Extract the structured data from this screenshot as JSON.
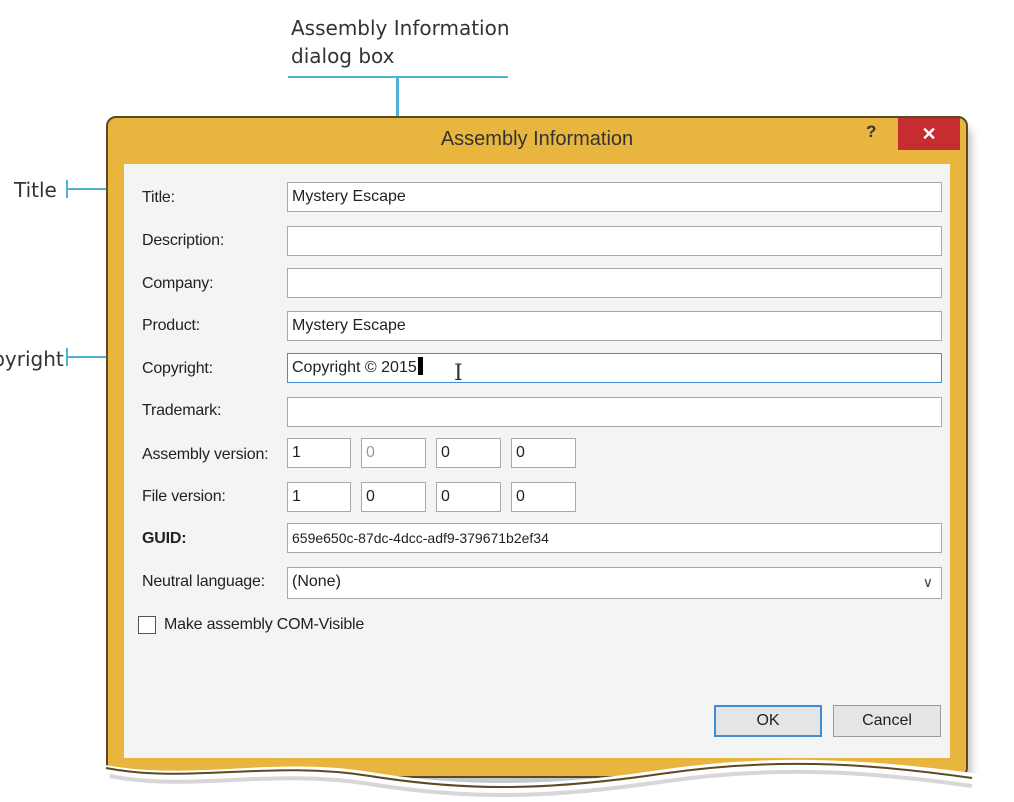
{
  "callouts": {
    "dialog": "Assembly Information\ndialog box",
    "title": "Title",
    "copyright": "Copyright"
  },
  "dialog": {
    "title": "Assembly Information",
    "help": "?",
    "close": "✕",
    "labels": {
      "title": "Title:",
      "description": "Description:",
      "company": "Company:",
      "product": "Product:",
      "copyright": "Copyright:",
      "trademark": "Trademark:",
      "assembly_version": "Assembly version:",
      "file_version": "File version:",
      "guid": "GUID:",
      "neutral_language": "Neutral language:"
    },
    "values": {
      "title": "Mystery Escape",
      "description": "",
      "company": "",
      "product": "Mystery Escape",
      "copyright": "Copyright ©  2015",
      "trademark": "",
      "assembly_version": [
        "1",
        "0",
        "0",
        "0"
      ],
      "file_version": [
        "1",
        "0",
        "0",
        "0"
      ],
      "guid": "659e650c-87dc-4dcc-adf9-379671b2ef34",
      "neutral_language": "(None)"
    },
    "com_visible_label": "Make assembly COM-Visible",
    "ok": "OK",
    "cancel": "Cancel"
  },
  "colors": {
    "frame": "#e8b63e",
    "close": "#c62d31",
    "callout_line": "#4fb3d6"
  }
}
